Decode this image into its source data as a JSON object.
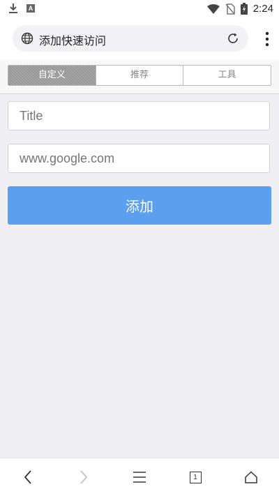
{
  "status_bar": {
    "time": "2:24",
    "left_icons": [
      "download-icon",
      "text-a-icon"
    ],
    "right_icons": [
      "wifi-icon",
      "no-sim-icon",
      "battery-charging-icon"
    ],
    "text_icon_letter": "A"
  },
  "toolbar": {
    "address_text": "添加快速访问",
    "icons": [
      "globe-icon",
      "reload-icon",
      "overflow-menu-icon"
    ]
  },
  "tabs": {
    "items": [
      {
        "label": "自定义",
        "active": true
      },
      {
        "label": "推荐",
        "active": false
      },
      {
        "label": "工具",
        "active": false
      }
    ]
  },
  "form": {
    "title_placeholder": "Title",
    "title_value": "",
    "url_placeholder": "www.google.com",
    "url_value": "",
    "add_label": "添加"
  },
  "bottom_nav": {
    "icons": [
      "back-icon",
      "forward-icon",
      "menu-icon",
      "tabs-icon",
      "home-icon"
    ],
    "tab_count": "1"
  },
  "colors": {
    "accent": "#5aa0ef",
    "background": "#efeff4",
    "segment_active": "#9a9a9a"
  }
}
